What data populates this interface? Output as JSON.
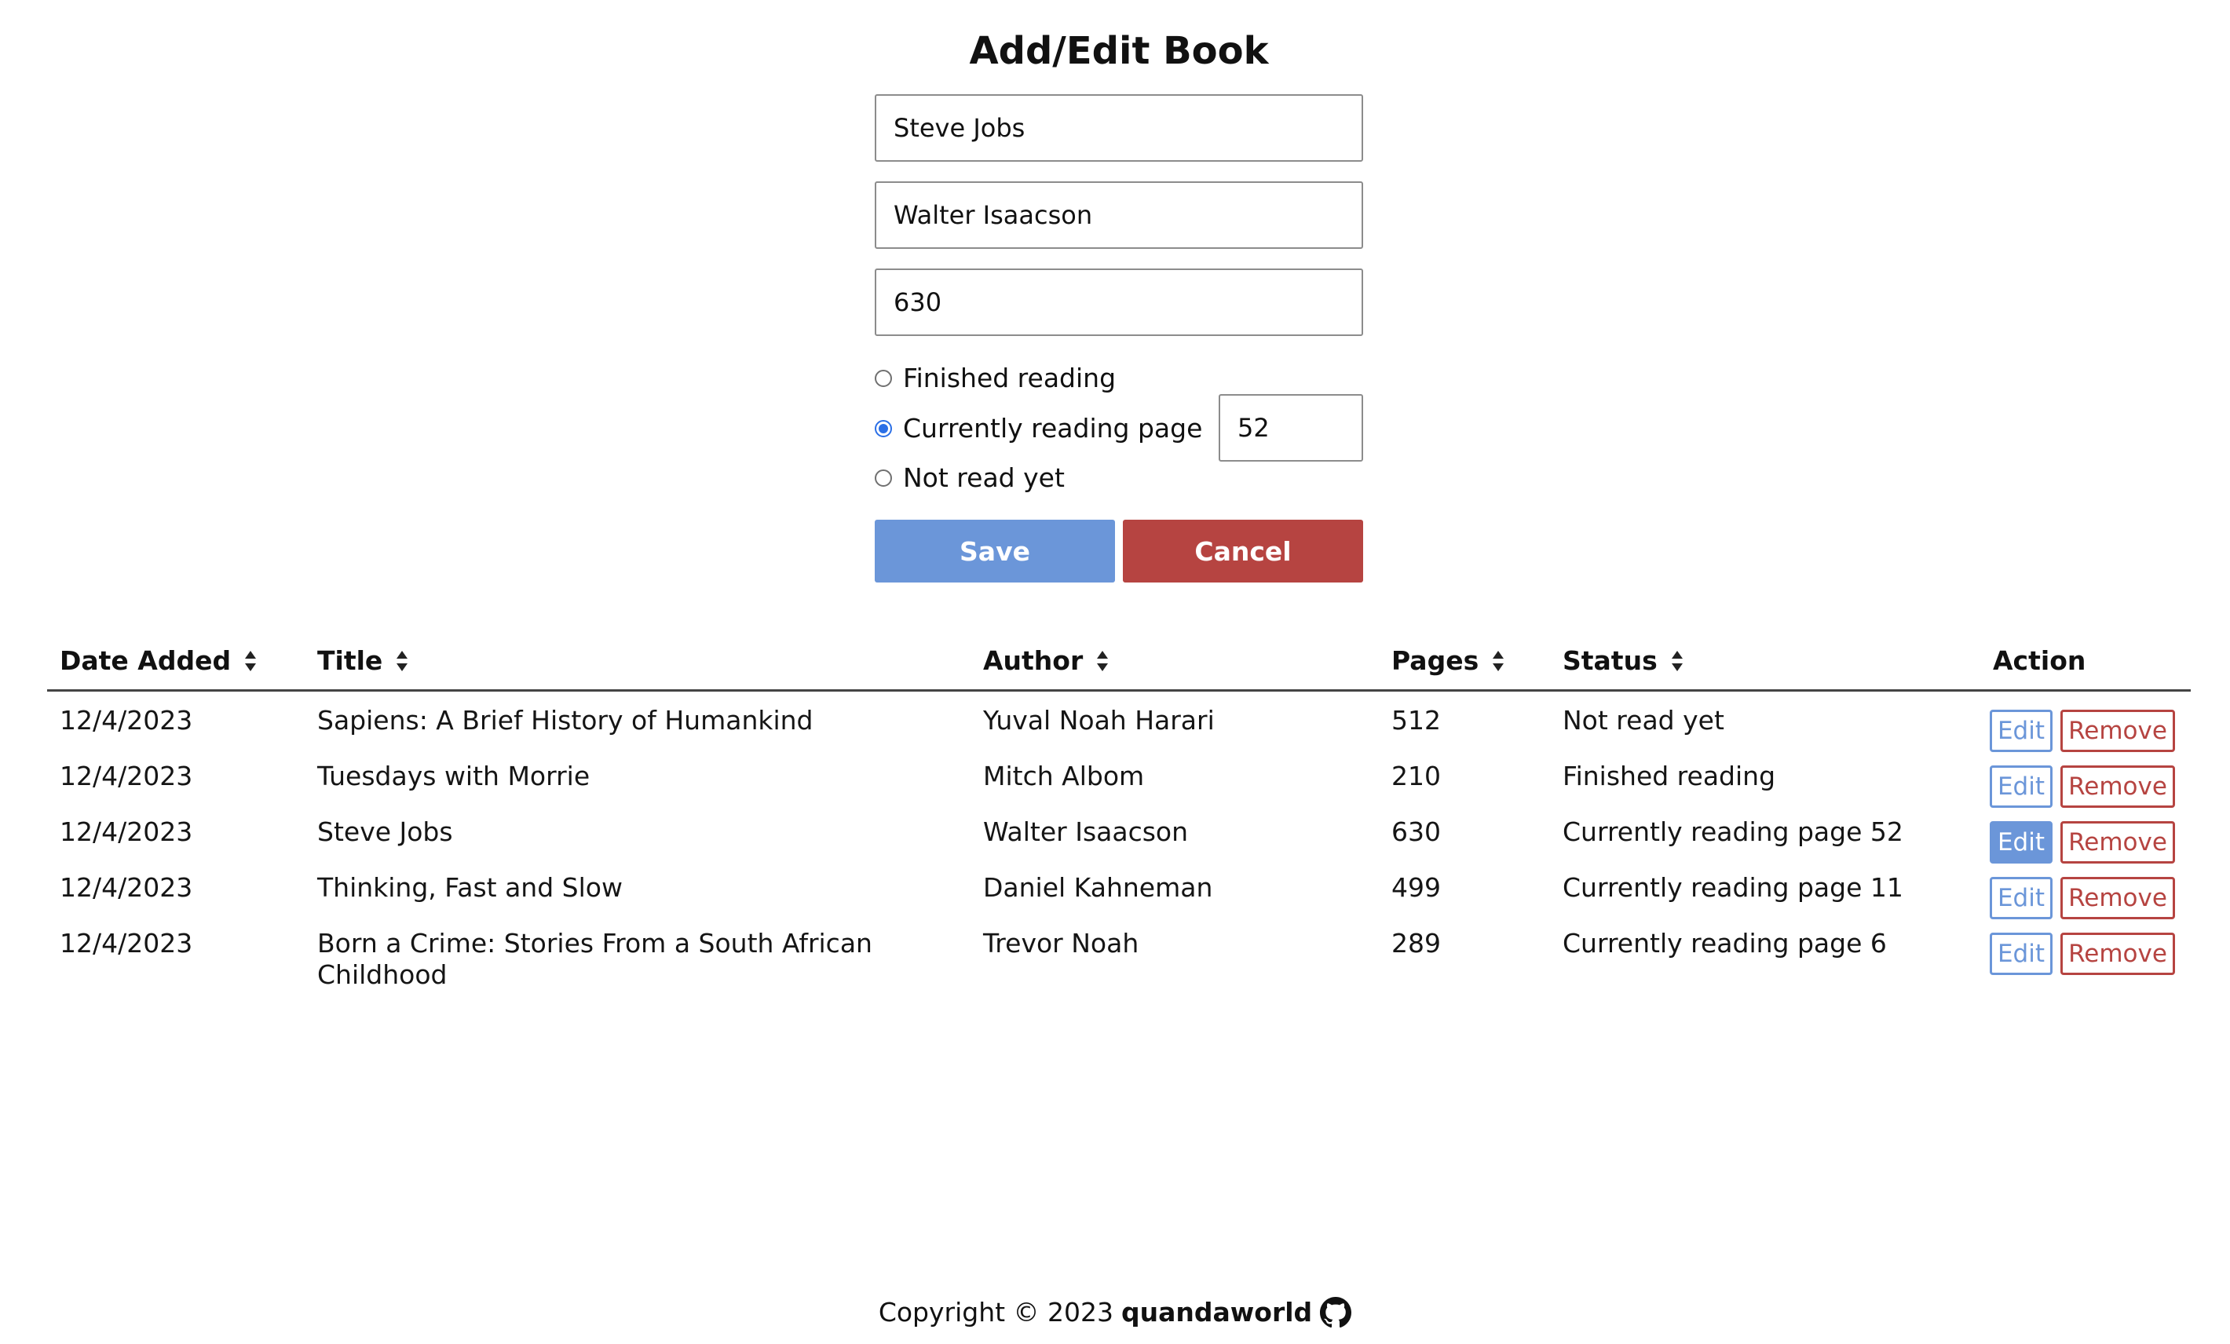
{
  "form": {
    "title": "Add/Edit Book",
    "title_value": "Steve Jobs",
    "author_value": "Walter Isaacson",
    "pages_value": "630",
    "radios": [
      {
        "label": "Finished reading",
        "checked": false
      },
      {
        "label": "Currently reading page",
        "checked": true
      },
      {
        "label": "Not read yet",
        "checked": false
      }
    ],
    "current_page_value": "52",
    "save_label": "Save",
    "cancel_label": "Cancel",
    "colors": {
      "save": "#6b96d9",
      "cancel": "#b64441"
    }
  },
  "table": {
    "headers": [
      "Date Added",
      "Title",
      "Author",
      "Pages",
      "Status",
      "Action"
    ],
    "rows": [
      {
        "date": "12/4/2023",
        "title": "Sapiens: A Brief History of Humankind",
        "author": "Yuval Noah Harari",
        "pages": "512",
        "status": "Not read yet",
        "edit": "Edit",
        "remove": "Remove"
      },
      {
        "date": "12/4/2023",
        "title": "Tuesdays with Morrie",
        "author": "Mitch Albom",
        "pages": "210",
        "status": "Finished reading",
        "edit": "Edit",
        "remove": "Remove"
      },
      {
        "date": "12/4/2023",
        "title": "Steve Jobs",
        "author": "Walter Isaacson",
        "pages": "630",
        "status": "Currently reading page 52",
        "edit": "Edit",
        "remove": "Remove"
      },
      {
        "date": "12/4/2023",
        "title": "Thinking, Fast and Slow",
        "author": "Daniel Kahneman",
        "pages": "499",
        "status": "Currently reading page 11",
        "edit": "Edit",
        "remove": "Remove"
      },
      {
        "date": "12/4/2023",
        "title": "Born a Crime: Stories From a South African Childhood",
        "author": "Trevor Noah",
        "pages": "289",
        "status": "Currently reading page 6",
        "edit": "Edit",
        "remove": "Remove"
      }
    ],
    "active_row": 2
  },
  "footer": {
    "copyright": "Copyright © 2023",
    "brand": "quandaworld",
    "icon": "github-icon"
  }
}
